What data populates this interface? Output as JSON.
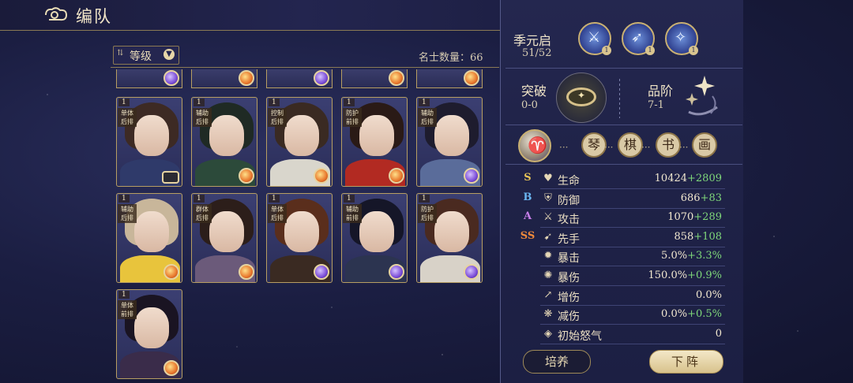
{
  "header": {
    "title": "编队",
    "back_icon": "cloud-swirl-back-icon"
  },
  "toolbar": {
    "sort_label": "等级",
    "count_label": "名士数量：66"
  },
  "roster": {
    "partial_row": [
      {
        "orb": "arcane"
      },
      {
        "orb": "fire"
      },
      {
        "orb": "arcane"
      },
      {
        "orb": "fire"
      },
      {
        "orb": "fire"
      }
    ],
    "cards": [
      {
        "level": "1",
        "tag": "单体\n后排",
        "orb": "scroll",
        "hair": "#3d2a24",
        "robe": "#2f3a6a"
      },
      {
        "level": "1",
        "tag": "辅助\n后排",
        "orb": "fire",
        "hair": "#1f2a24",
        "robe": "#2c4a3a"
      },
      {
        "level": "1",
        "tag": "控制\n后排",
        "orb": "fire",
        "hair": "#3a2a22",
        "robe": "#d9d6cc"
      },
      {
        "level": "1",
        "tag": "防护\n前排",
        "orb": "fire",
        "hair": "#2a1a16",
        "robe": "#b22a22"
      },
      {
        "level": "1",
        "tag": "辅助\n后排",
        "orb": "arcane",
        "hair": "#1e1c2e",
        "robe": "#5a6c9a"
      },
      {
        "level": "1",
        "tag": "辅助\n后排",
        "orb": "fire",
        "hair": "#c8b69a",
        "robe": "#e8c43c"
      },
      {
        "level": "1",
        "tag": "群体\n后排",
        "orb": "fire",
        "hair": "#2c1e1a",
        "robe": "#6b5a7a"
      },
      {
        "level": "1",
        "tag": "单体\n后排",
        "orb": "arcane",
        "hair": "#5a2e1c",
        "robe": "#3a2a22"
      },
      {
        "level": "1",
        "tag": "辅助\n前排",
        "orb": "arcane",
        "hair": "#151628",
        "robe": "#2c3450"
      },
      {
        "level": "1",
        "tag": "防护\n后排",
        "orb": "arcane",
        "hair": "#4a2a20",
        "robe": "#d8d2c8"
      },
      {
        "level": "1",
        "tag": "单体\n前排",
        "orb": "fire",
        "hair": "#1a1422",
        "robe": "#3a2c4a"
      }
    ]
  },
  "hero": {
    "name": "季元启",
    "level": "51/52",
    "skills": [
      {
        "icon": "sword-slash-icon",
        "num": "1"
      },
      {
        "icon": "bow-swirl-icon",
        "num": "1"
      },
      {
        "icon": "blade-burst-icon",
        "num": "1"
      }
    ],
    "breakthrough": {
      "label": "突破",
      "value": "0-0"
    },
    "grade": {
      "label": "品阶",
      "value": "7-1"
    },
    "arts": [
      "琴",
      "棋",
      "书",
      "画"
    ],
    "stats": [
      {
        "rank": "S",
        "rank_color": "#e8c457",
        "icon": "♥",
        "name": "生命",
        "base": "10424",
        "bonus": "+2809"
      },
      {
        "rank": "B",
        "rank_color": "#6ab5f0",
        "icon": "⛨",
        "name": "防御",
        "base": "686",
        "bonus": "+83"
      },
      {
        "rank": "A",
        "rank_color": "#c77ee8",
        "icon": "⚔",
        "name": "攻击",
        "base": "1070",
        "bonus": "+289"
      },
      {
        "rank": "SS",
        "rank_color": "#f08a3c",
        "icon": "➹",
        "name": "先手",
        "base": "858",
        "bonus": "+108"
      },
      {
        "rank": "",
        "rank_color": "#000000",
        "icon": "✹",
        "name": "暴击",
        "base": "5.0%",
        "bonus": "+3.3%"
      },
      {
        "rank": "",
        "rank_color": "#000000",
        "icon": "✺",
        "name": "暴伤",
        "base": "150.0%",
        "bonus": "+0.9%"
      },
      {
        "rank": "",
        "rank_color": "#000000",
        "icon": "↗",
        "name": "增伤",
        "base": "0.0%",
        "bonus": ""
      },
      {
        "rank": "",
        "rank_color": "#000000",
        "icon": "❋",
        "name": "减伤",
        "base": "0.0%",
        "bonus": "+0.5%"
      },
      {
        "rank": "",
        "rank_color": "#000000",
        "icon": "◈",
        "name": "初始怒气",
        "base": "0",
        "bonus": ""
      }
    ]
  },
  "actions": {
    "train": "培养",
    "remove": "下阵"
  }
}
